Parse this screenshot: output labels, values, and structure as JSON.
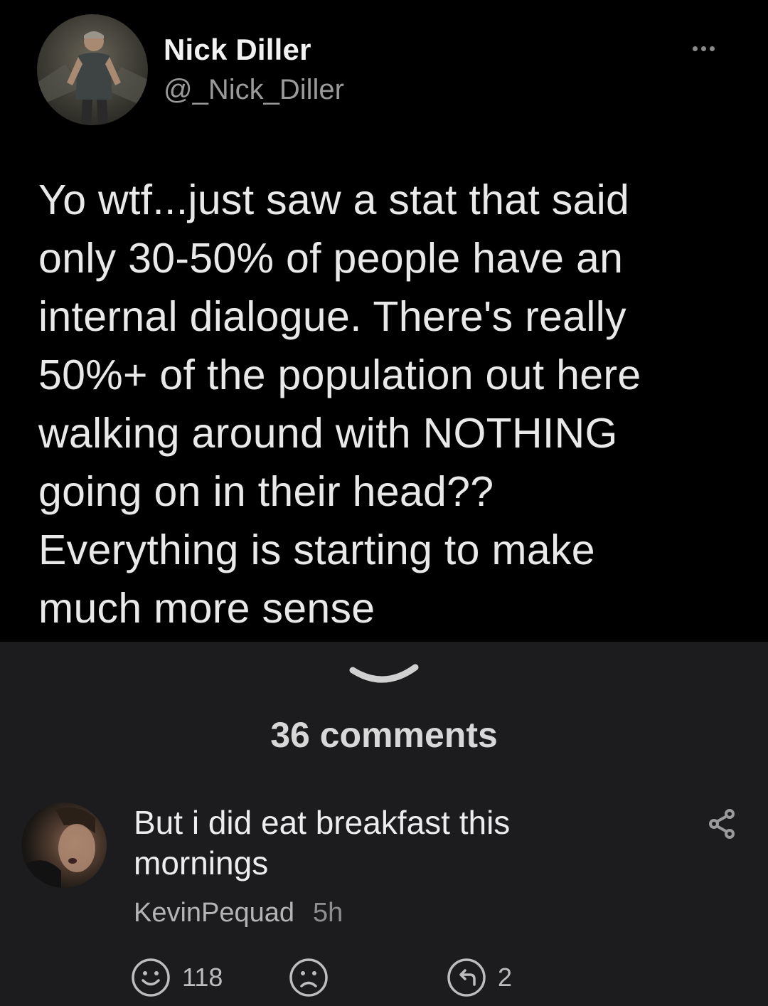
{
  "tweet": {
    "author_name": "Nick Diller",
    "author_handle": "@_Nick_Diller",
    "text_lines": [
      "Yo wtf...just saw a stat that said",
      "only 30-50% of people have an",
      "internal dialogue.  There's really",
      "50%+ of the population out here",
      "walking around with NOTHING",
      "going on in their head??",
      "Everything is starting to make",
      "much more sense"
    ]
  },
  "comments_header": {
    "count_label": "36 comments"
  },
  "comment": {
    "text_lines": [
      "But i did eat breakfast this",
      "mornings"
    ],
    "author": "KevinPequad",
    "time": "5h",
    "actions": {
      "like_count": "118",
      "reply_count": "2"
    }
  },
  "colors": {
    "tweet_background": "#000000",
    "page_background": "#1c1c1f"
  }
}
